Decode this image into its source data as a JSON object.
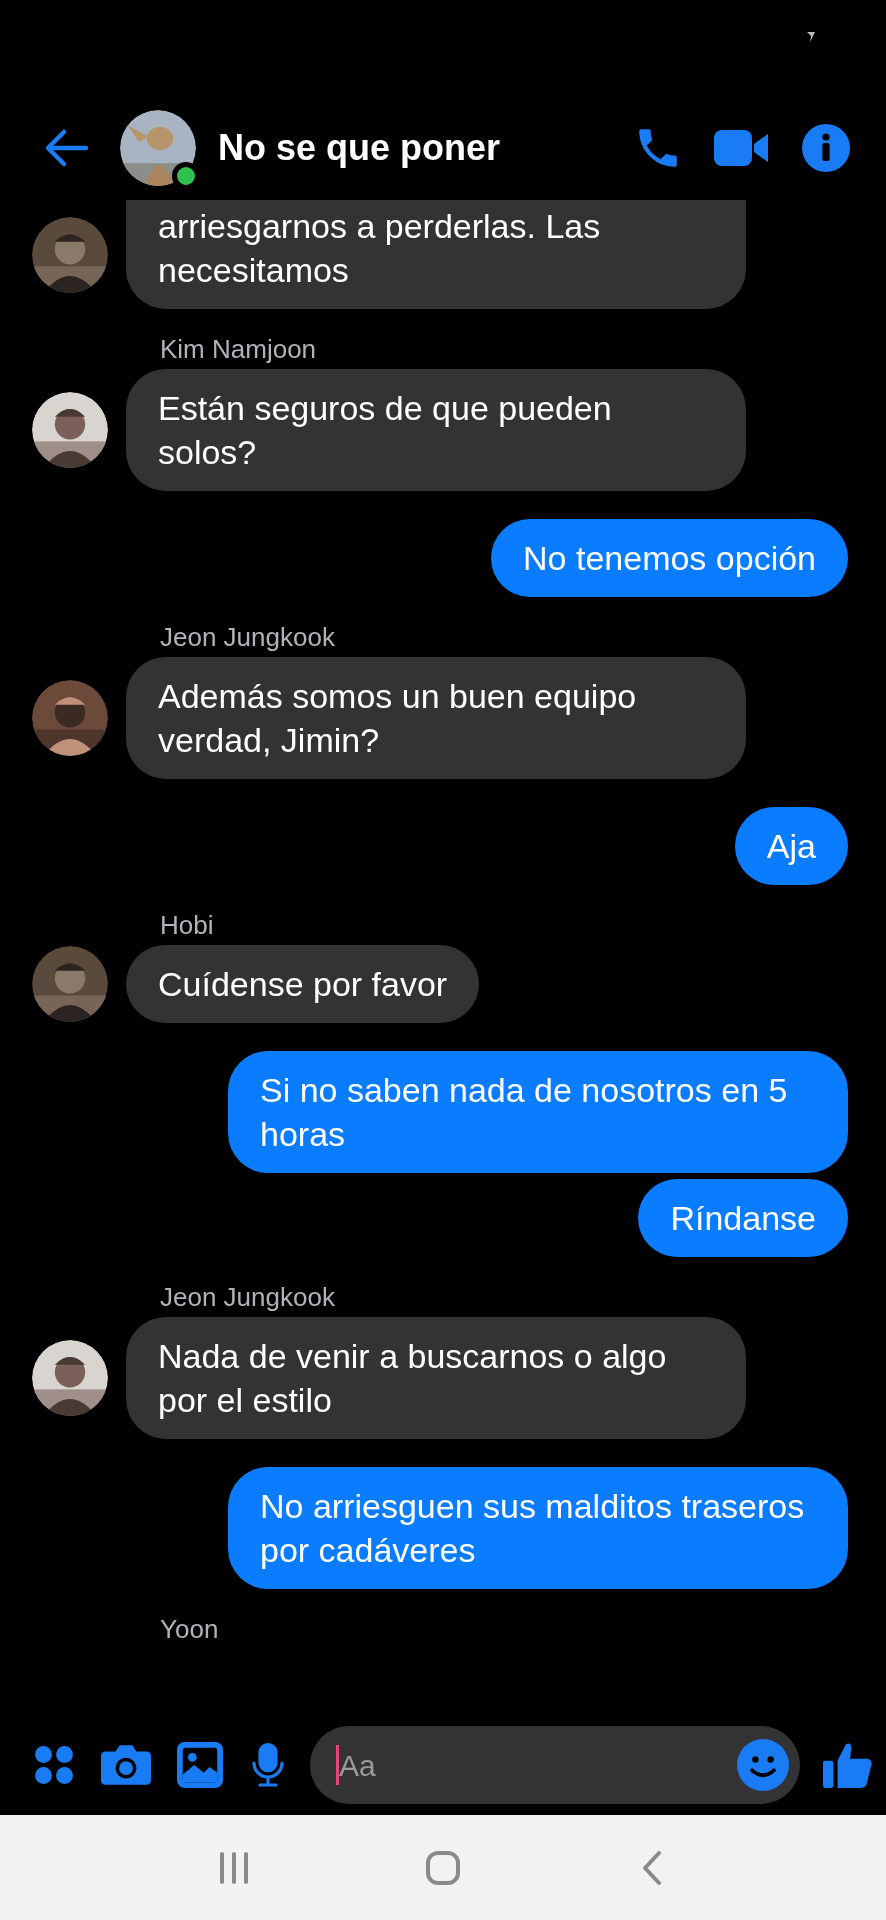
{
  "header": {
    "title": "No se que poner",
    "online": true
  },
  "messages": [
    {
      "kind": "received",
      "text": "arriesgarnos a perderlas. Las necesitamos"
    },
    {
      "kind": "name",
      "text": "Kim Namjoon"
    },
    {
      "kind": "received",
      "text": "Están seguros de que pueden solos?"
    },
    {
      "kind": "sent",
      "text": "No tenemos opción"
    },
    {
      "kind": "name",
      "text": "Jeon Jungkook"
    },
    {
      "kind": "received",
      "text": "Además somos un buen equipo verdad, Jimin?"
    },
    {
      "kind": "sent",
      "text": "Aja"
    },
    {
      "kind": "name",
      "text": "Hobi"
    },
    {
      "kind": "received",
      "text": "Cuídense por favor"
    },
    {
      "kind": "sent",
      "text": "Si no saben nada de nosotros en 5 horas"
    },
    {
      "kind": "sent",
      "text": "Ríndanse"
    },
    {
      "kind": "name",
      "text": "Jeon Jungkook"
    },
    {
      "kind": "received",
      "text": "Nada de venir a buscarnos o algo por el estilo"
    },
    {
      "kind": "sent",
      "text": "No arriesguen sus malditos traseros por cadáveres"
    },
    {
      "kind": "name",
      "text": "Yoon"
    }
  ],
  "input": {
    "placeholder": "Aa"
  }
}
